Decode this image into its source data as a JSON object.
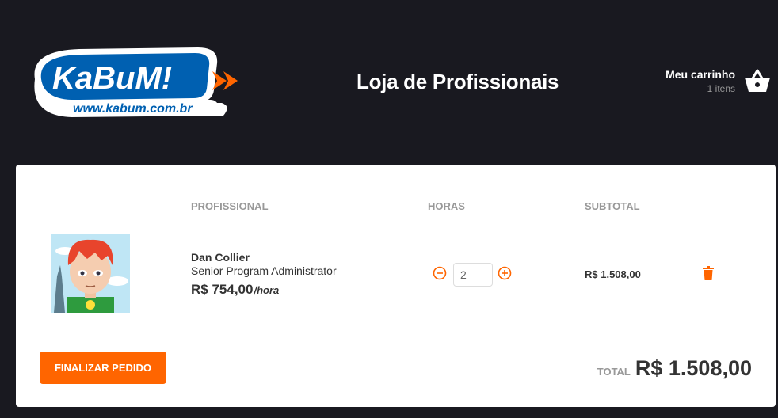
{
  "header": {
    "logo_text": "KaBuM!",
    "logo_url_text": "www.kabum.com.br",
    "title": "Loja de Profissionais",
    "cart": {
      "label": "Meu carrinho",
      "count": "1 itens",
      "icon": "basket-icon"
    }
  },
  "table": {
    "columns": [
      "PROFISSIONAL",
      "HORAS",
      "SUBTOTAL"
    ],
    "rows": [
      {
        "name": "Dan Collier",
        "role": "Senior Program Administrator",
        "price": "R$ 754,00",
        "price_unit": "/hora",
        "hours": "2",
        "subtotal": "R$ 1.508,00",
        "avatar": "cartoon-avatar"
      }
    ]
  },
  "footer": {
    "checkout_label": "FINALIZAR PEDIDO",
    "total_label": "TOTAL",
    "total_value": "R$ 1.508,00"
  },
  "colors": {
    "background": "#191920",
    "accent": "#ff6500",
    "brand_blue": "#0060b1",
    "panel": "#ffffff",
    "header_text": "#999999"
  }
}
